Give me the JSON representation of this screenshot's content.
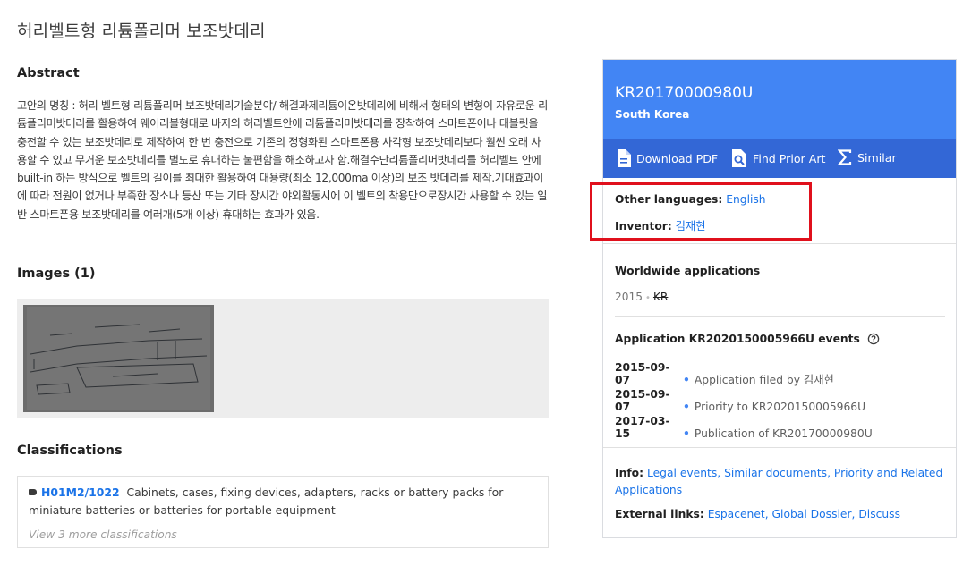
{
  "page": {
    "title": "허리벨트형 리튬폴리머 보조밧데리"
  },
  "abstract": {
    "heading": "Abstract",
    "text": "고안의 명칭 : 허리 벨트형 리튬폴리머 보조밧데리기술분야/ 해결과제리튬이온밧데리에 비해서 형태의 변형이 자유로운 리튬폴리머밧데리를 활용하여 웨어러블형태로 바지의 허리벨트안에 리튬폴리머밧데리를 장착하여 스마트폰이나 태블릿을 충전할 수 있는 보조밧데리로 제작하여 한 번 충전으로 기존의 정형화된 스마트폰용 사각형 보조밧데리보다 훨씬 오래 사용할 수 있고 무거운 보조밧데리를 별도로 휴대하는 불편함을 해소하고자 함.해결수단리튬폴리머밧데리를 허리벨트 안에 built-in 하는 방식으로 벨트의 길이를 최대한 활용하여 대용량(최소 12,000ma 이상)의 보조 밧데리를 제작.기대효과이에 따라 전원이 없거나 부족한 장소나 등산 또는 기타 장시간 야외활동시에 이 벨트의 착용만으로장시간 사용할 수 있는 일반 스마트폰용 보조밧데리를 여러개(5개 이상) 휴대하는 효과가 있음."
  },
  "images": {
    "heading": "Images (1)"
  },
  "classifications": {
    "heading": "Classifications",
    "code": "H01M2/1022",
    "description": "Cabinets, cases, fixing devices, adapters, racks or battery packs for miniature batteries or batteries for portable equipment",
    "more": "View 3 more classifications"
  },
  "sidebar": {
    "pub_number": "KR20170000980U",
    "country": "South Korea",
    "actions": {
      "download": "Download PDF",
      "prior_art": "Find Prior Art",
      "similar": "Similar"
    },
    "other_languages_label": "Other languages:",
    "other_languages_value": "English",
    "inventor_label": "Inventor:",
    "inventor_value": "김재현",
    "worldwide_heading": "Worldwide applications",
    "worldwide_year": "2015",
    "worldwide_country": "KR",
    "events_label": "Application KR2020150005966U events",
    "events": [
      {
        "date": "2015-09-07",
        "text": "Application filed by 김재현"
      },
      {
        "date": "2015-09-07",
        "text": "Priority to KR2020150005966U"
      },
      {
        "date": "2017-03-15",
        "text": "Publication of KR20170000980U"
      }
    ],
    "info_label": "Info:",
    "info_links": "Legal events, Similar documents, Priority and Related Applications",
    "external_label": "External links:",
    "external_links": "Espacenet, Global Dossier, Discuss"
  },
  "colors": {
    "header_blue": "#4285f4",
    "action_blue": "#3367d6",
    "link_blue": "#1a73e8",
    "highlight_red": "#e0101c"
  }
}
